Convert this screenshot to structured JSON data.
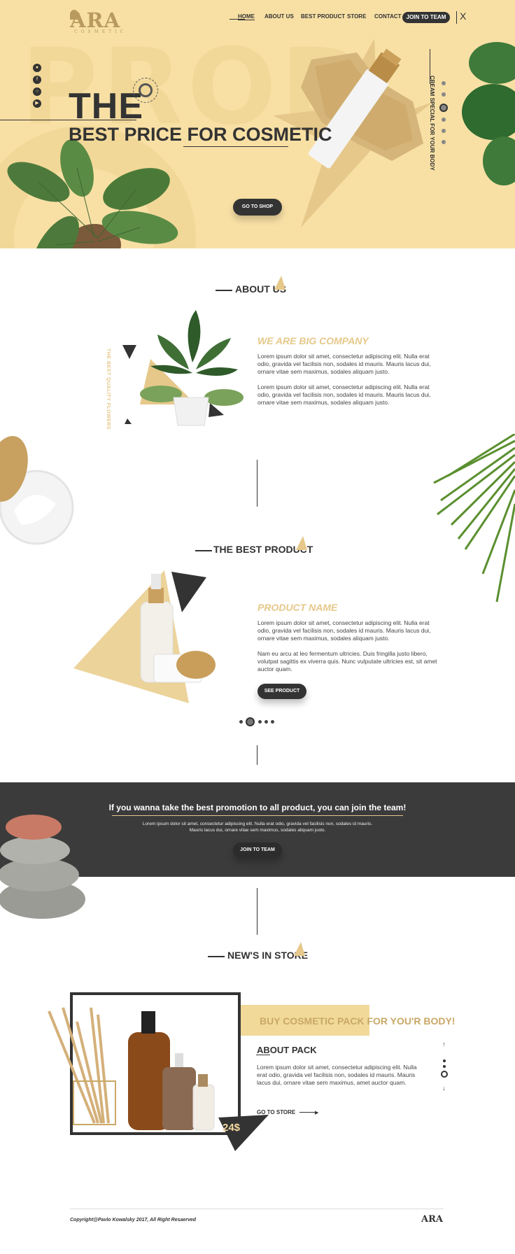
{
  "brand": {
    "logo": "ARA",
    "sub": "COSMETIC",
    "footer_logo": "ARA"
  },
  "nav": {
    "items": [
      {
        "label": "HOME",
        "active": true
      },
      {
        "label": "ABOUT US"
      },
      {
        "label": "BEST PRODUCT"
      },
      {
        "label": "STORE"
      },
      {
        "label": "CONTACT"
      }
    ],
    "join": "JOIN TO TEAM",
    "close": "X"
  },
  "hero": {
    "bg_word": "PROD",
    "title": "THE",
    "subtitle": "BEST PRICE FOR COSMETIC",
    "button": "GO TO SHOP",
    "vertical_text": "CREAM SPECIAL FOR YOUR BODY",
    "social": [
      "snapchat-icon",
      "facebook-icon",
      "instagram-icon",
      "youtube-icon"
    ]
  },
  "about": {
    "title": "ABOUT US",
    "vertical": "THE BEST QUALITY FLOWERS",
    "heading": "WE ARE BIG COMPANY",
    "p1": "Lorem ipsum dolor sit amet, consectetur adipiscing elit. Nulla erat odio, gravida vel facilisis non, sodales id mauris. Mauris lacus dui, ornare vitae sem maximus, sodales aliquam justo.",
    "p2": "Lorem ipsum dolor sit amet, consectetur adipiscing elit. Nulla erat odio, gravida vel facilisis non, sodales id mauris. Mauris lacus dui, ornare vitae sem maximus, sodales aliquam justo."
  },
  "product": {
    "title": "THE BEST PRODUCT",
    "heading": "PRODUCT NAME",
    "p1": "Lorem ipsum dolor sit amet, consectetur adipiscing elit. Nulla erat odio, gravida vel facilisis non, sodales id mauris. Mauris lacus dui, ornare vitae sem maximus, sodales aliquam justo.",
    "p2": "Nam eu arcu at leo fermentum ultricies. Duis fringilla justo libero, volutpat sagittis ex viverra quis. Nunc vulputate ultricies est, sit amet auctor quam.",
    "button": "SEE PRODUCT"
  },
  "promo": {
    "title": "If you wanna take the best promotion to all product, you can join the team!",
    "text": "Lorem ipsum dolor sit amet, consectetur adipiscing elit. Nulla erat odio, gravida vel facilisis non, sodales id mauris. Mauris lacus dui, ornare vitae sem maximus, sodales aliquam justo.",
    "button": "JOIN TO TEAM"
  },
  "store": {
    "title": "NEW'S IN STORE",
    "banner": "BUY COSMETIC PACK FOR YOU'R BODY!",
    "heading": "ABOUT PACK",
    "text": "Lorem ipsum dolor sit amet, consectetur adipiscing elit. Nulla erat odio, gravida vel facilisis non, sodales id mauris. Mauris lacus dui, ornare vitae sem maximus, amet auctor quam.",
    "link": "GO TO STORE",
    "price": "24$"
  },
  "footer": {
    "copyright": "Copyright@Pavlo Kowalsky 2017, All Right Resaerved"
  },
  "colors": {
    "gold": "#e6c88a",
    "hero_bg": "#f8e0a5",
    "dark": "#333333"
  }
}
